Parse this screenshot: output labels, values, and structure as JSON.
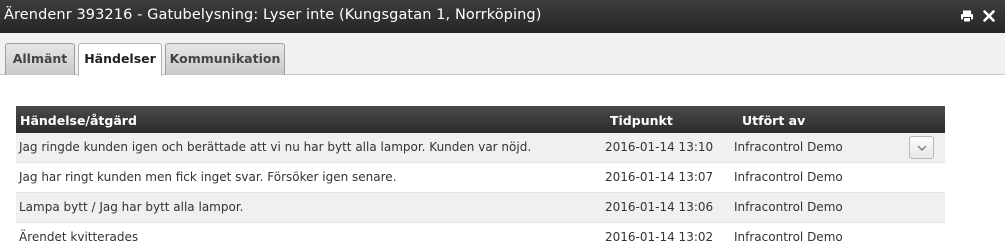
{
  "window": {
    "title": "Ärendenr 393216 - Gatubelysning: Lyser inte (Kungsgatan 1, Norrköping)",
    "icons": [
      "print-icon",
      "close-icon"
    ]
  },
  "tabs": [
    {
      "label": "Allmänt",
      "active": false
    },
    {
      "label": "Händelser",
      "active": true
    },
    {
      "label": "Kommunikation",
      "active": false
    }
  ],
  "table": {
    "columns": [
      "Händelse/åtgärd",
      "Tidpunkt",
      "Utfört av"
    ],
    "rows": [
      {
        "event": "Jag ringde kunden igen och berättade att vi nu har bytt alla lampor. Kunden var nöjd.",
        "time": "2016-01-14 13:10",
        "by": "Infracontrol Demo"
      },
      {
        "event": "Jag har ringt kunden men fick inget svar. Försöker igen senare.",
        "time": "2016-01-14 13:07",
        "by": "Infracontrol Demo"
      },
      {
        "event": "Lampa bytt / Jag har bytt alla lampor.",
        "time": "2016-01-14 13:06",
        "by": "Infracontrol Demo"
      },
      {
        "event": "Ärendet kvitterades",
        "time": "2016-01-14 13:02",
        "by": "Infracontrol Demo"
      }
    ],
    "row_action_icon": "chevron-down-icon"
  },
  "colors": {
    "titlebar": "#333333",
    "header": "#3a3a3a",
    "row_alt": "#f0f0f0"
  }
}
